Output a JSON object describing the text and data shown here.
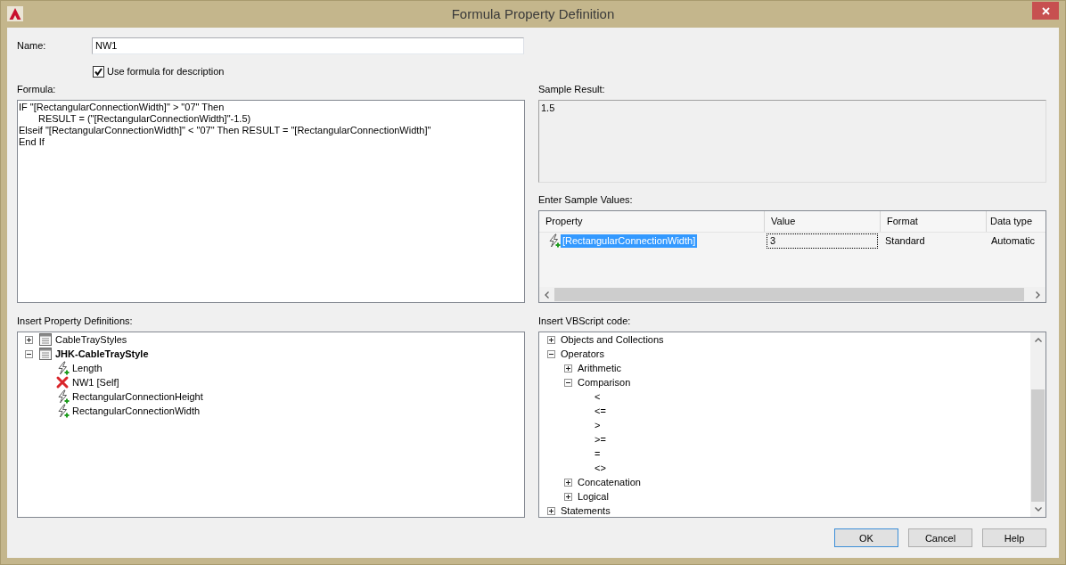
{
  "window": {
    "title": "Formula Property Definition"
  },
  "name_field": {
    "label": "Name:",
    "value": "NW1"
  },
  "use_formula_checkbox": {
    "label": "Use formula for description",
    "checked": true
  },
  "formula": {
    "label": "Formula:",
    "value": "IF \"[RectangularConnectionWidth]\" > \"07\" Then\n\tRESULT = (\"[RectangularConnectionWidth]\"-1.5)\nElseif \"[RectangularConnectionWidth]\" < \"07\" Then RESULT = \"[RectangularConnectionWidth]\"\nEnd If"
  },
  "sample_result": {
    "label": "Sample Result:",
    "value": "1.5"
  },
  "sample_values": {
    "label": "Enter Sample Values:",
    "columns": [
      "Property",
      "Value",
      "Format",
      "Data type"
    ],
    "rows": [
      {
        "selected": true,
        "cells": [
          {
            "text": "[RectangularConnectionWidth]",
            "focused": false
          },
          {
            "text": "3",
            "focused": true
          },
          {
            "text": "Standard",
            "focused": false
          },
          {
            "text": "Automatic",
            "focused": false
          }
        ]
      }
    ]
  },
  "property_tree": {
    "label": "Insert Property Definitions:",
    "items": [
      {
        "label": "CableTrayStyles",
        "kind": "property-set",
        "current": false,
        "expanded": false
      },
      {
        "label": "JHK-CableTrayStyle",
        "kind": "property-set",
        "current": true,
        "expanded": true,
        "children": [
          {
            "label": "Length",
            "kind": "property"
          },
          {
            "label": "NW1 [Self]",
            "kind": "self"
          },
          {
            "label": "RectangularConnectionHeight",
            "kind": "property"
          },
          {
            "label": "RectangularConnectionWidth",
            "kind": "property"
          }
        ]
      }
    ]
  },
  "vbscript_tree": {
    "label": "Insert VBScript code:",
    "items": [
      {
        "label": "Objects and Collections",
        "expanded": false
      },
      {
        "label": "Operators",
        "expanded": true,
        "children": [
          {
            "label": "Arithmetic",
            "expanded": false
          },
          {
            "label": "Comparison",
            "expanded": true,
            "children": [
              {
                "label": "<"
              },
              {
                "label": "<="
              },
              {
                "label": ">"
              },
              {
                "label": ">="
              },
              {
                "label": "="
              },
              {
                "label": "<>"
              }
            ]
          },
          {
            "label": "Concatenation",
            "expanded": false
          },
          {
            "label": "Logical",
            "expanded": false
          }
        ]
      },
      {
        "label": "Statements",
        "expanded": false
      }
    ]
  },
  "buttons": [
    {
      "label": "OK",
      "default": true
    },
    {
      "label": "Cancel",
      "default": false
    },
    {
      "label": "Help",
      "default": false
    }
  ]
}
